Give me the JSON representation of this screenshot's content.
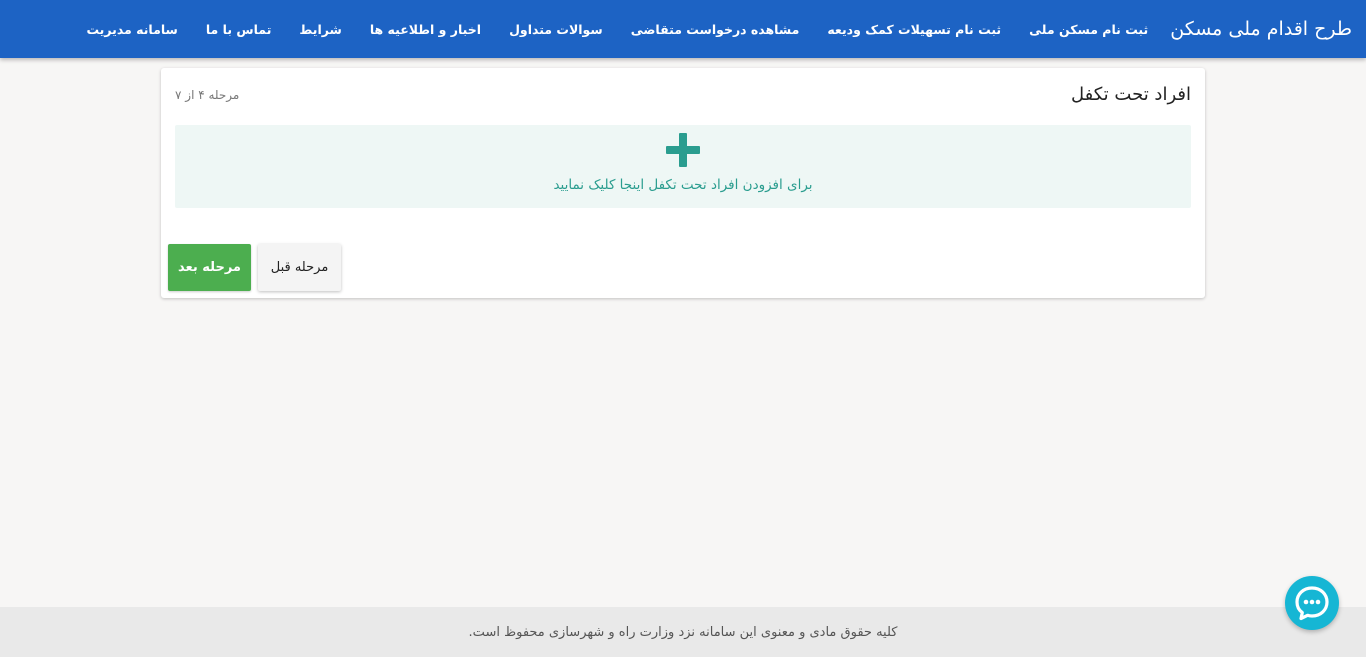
{
  "header": {
    "brand": "طرح اقدام ملی مسکن",
    "nav": [
      "ثبت نام مسکن ملی",
      "ثبت نام تسهیلات کمک ودیعه",
      "مشاهده درخواست متقاضی",
      "سوالات متداول",
      "اخبار و اطلاعیه ها",
      "شرایط",
      "تماس با ما",
      "سامانه مدیریت"
    ]
  },
  "card": {
    "title": "افراد تحت تکفل",
    "step": "مرحله ۴ از ۷",
    "add_prompt": "برای افزودن افراد تحت تکفل اینجا کلیک نمایید",
    "next_label": "مرحله بعد",
    "prev_label": "مرحله قبل"
  },
  "footer": {
    "copyright": "کلیه حقوق مادی و معنوی این سامانه نزد وزارت راه و شهرسازی محفوظ است."
  },
  "icons": {
    "add": "plus-icon",
    "chat": "chat-bubble-icon"
  },
  "colors": {
    "header": "#1d63c4",
    "accent": "#2a9d8f",
    "next_button": "#4cae4f",
    "chat": "#16b6d4"
  }
}
